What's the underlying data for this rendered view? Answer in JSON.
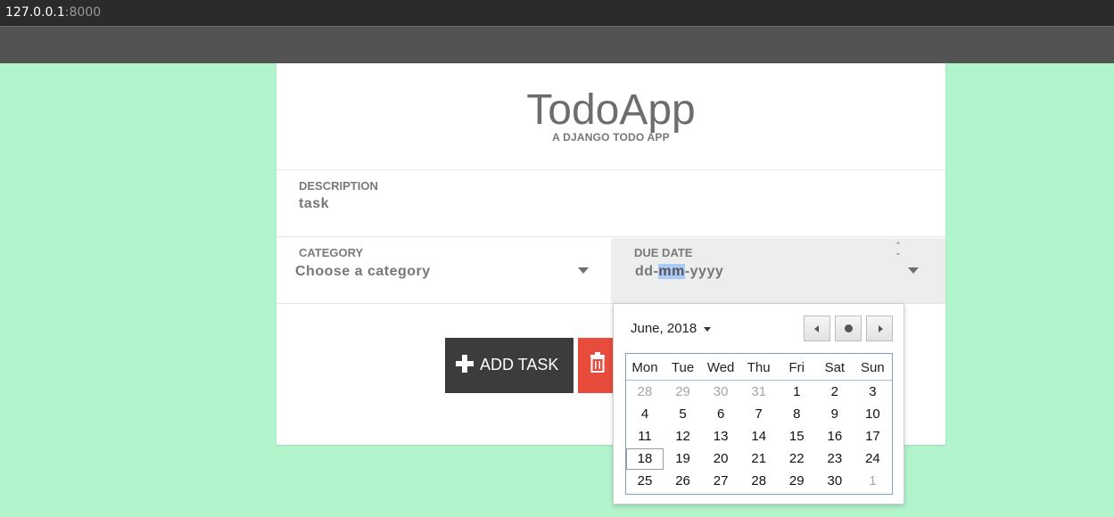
{
  "browser": {
    "url_host": "127.0.0.1",
    "url_port": ":8000"
  },
  "app": {
    "title": "TodoApp",
    "subtitle": "A DJANGO TODO APP"
  },
  "form": {
    "description_label": "DESCRIPTION",
    "description_value": "task",
    "category_label": "CATEGORY",
    "category_value": "Choose a category",
    "due_label": "DUE DATE",
    "due_dd": "dd-",
    "due_mm": "mm",
    "due_yyyy": "-yyyy"
  },
  "buttons": {
    "add_label": "ADD TASK"
  },
  "datepicker": {
    "month_label": "June, 2018",
    "weekdays": [
      "Mon",
      "Tue",
      "Wed",
      "Thu",
      "Fri",
      "Sat",
      "Sun"
    ],
    "weeks": [
      [
        "28",
        "29",
        "30",
        "31",
        "1",
        "2",
        "3"
      ],
      [
        "4",
        "5",
        "6",
        "7",
        "8",
        "9",
        "10"
      ],
      [
        "11",
        "12",
        "13",
        "14",
        "15",
        "16",
        "17"
      ],
      [
        "18",
        "19",
        "20",
        "21",
        "22",
        "23",
        "24"
      ],
      [
        "25",
        "26",
        "27",
        "28",
        "29",
        "30",
        "1"
      ]
    ],
    "today": "18"
  },
  "colors": {
    "background": "#b2f5cc",
    "add_button": "#3c3c3c",
    "delete_button": "#e74c3c",
    "highlight": "#aacbf7"
  },
  "icons": {
    "add": "plus-icon",
    "delete": "trash-icon",
    "prev": "prev-month-icon",
    "next": "next-month-icon",
    "today": "today-dot-icon"
  }
}
